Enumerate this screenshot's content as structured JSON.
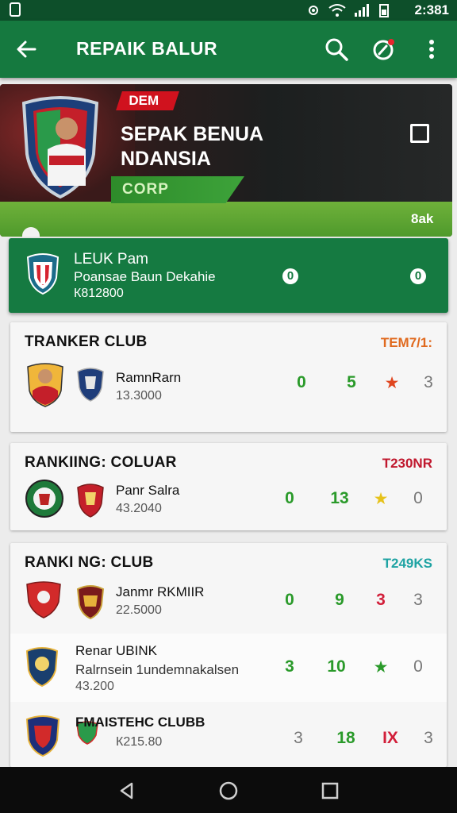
{
  "status_bar": {
    "time": "2:381"
  },
  "app_bar": {
    "title": "REPAIK BALUR"
  },
  "banner": {
    "tag": "DEM",
    "headline_line1": "SEPAK BENUA",
    "headline_line2": "NDANSIA",
    "green_label": "CORP",
    "corner_text": "8ak"
  },
  "league_card": {
    "name": "LEUK Pam",
    "subtitle": "Poansae Baun Dekahie",
    "number": "К812800",
    "score_left": "0",
    "score_right": "0"
  },
  "cards": [
    {
      "title": "TRANKER CLUB",
      "tag": "TEM7/1:",
      "tag_color": "#e06a1f",
      "rows": [
        {
          "name": "RamnRarn",
          "number": "13.3000",
          "stats": [
            "0",
            "5",
            "★",
            "3"
          ],
          "stat_colors": [
            "#2a9a2a",
            "#2a9a2a",
            "#e0461f",
            "#777777"
          ]
        }
      ]
    },
    {
      "title": "RANKIING: COLUAR",
      "tag": "T230NR",
      "tag_color": "#c0182e",
      "rows": [
        {
          "name": "Panr Salra",
          "number": "43.2040",
          "stats": [
            "0",
            "13",
            "★",
            "0"
          ],
          "stat_colors": [
            "#2a9a2a",
            "#2a9a2a",
            "#e6c21a",
            "#777777"
          ]
        }
      ]
    },
    {
      "title": "RANKI NG: CLUB",
      "tag": "T249KS",
      "tag_color": "#1fa3a3",
      "rows": [
        {
          "name": "Janmr RKMIIR",
          "number": "22.5000",
          "stats": [
            "0",
            "9",
            "3",
            "3"
          ],
          "stat_colors": [
            "#2a9a2a",
            "#2a9a2a",
            "#d21f3a",
            "#777777"
          ]
        },
        {
          "name": "Renar UBINK",
          "subtitle": "Ralrnsein 1undemnakalsen",
          "number": "43.200",
          "stats": [
            "3",
            "10",
            "★",
            "0"
          ],
          "stat_colors": [
            "#2a9a2a",
            "#2a9a2a",
            "#2a9a2a",
            "#777777"
          ]
        },
        {
          "name": "FMAISTEHC CLUBB",
          "number": "К215.80",
          "stats": [
            "3",
            "18",
            "IX",
            "3"
          ],
          "stat_colors": [
            "#777777",
            "#2a9a2a",
            "#d21f3a",
            "#777777"
          ]
        }
      ]
    }
  ],
  "icons": {
    "back": "arrow-left-icon",
    "search": "search-icon",
    "compass": "compass-icon",
    "more": "more-vert-icon",
    "nav_back": "nav-back-icon",
    "nav_home": "nav-home-icon",
    "nav_recent": "nav-recent-icon"
  },
  "colors": {
    "primary": "#15793f",
    "status_bar": "#0d4f2a",
    "accent_red": "#d0121e"
  }
}
